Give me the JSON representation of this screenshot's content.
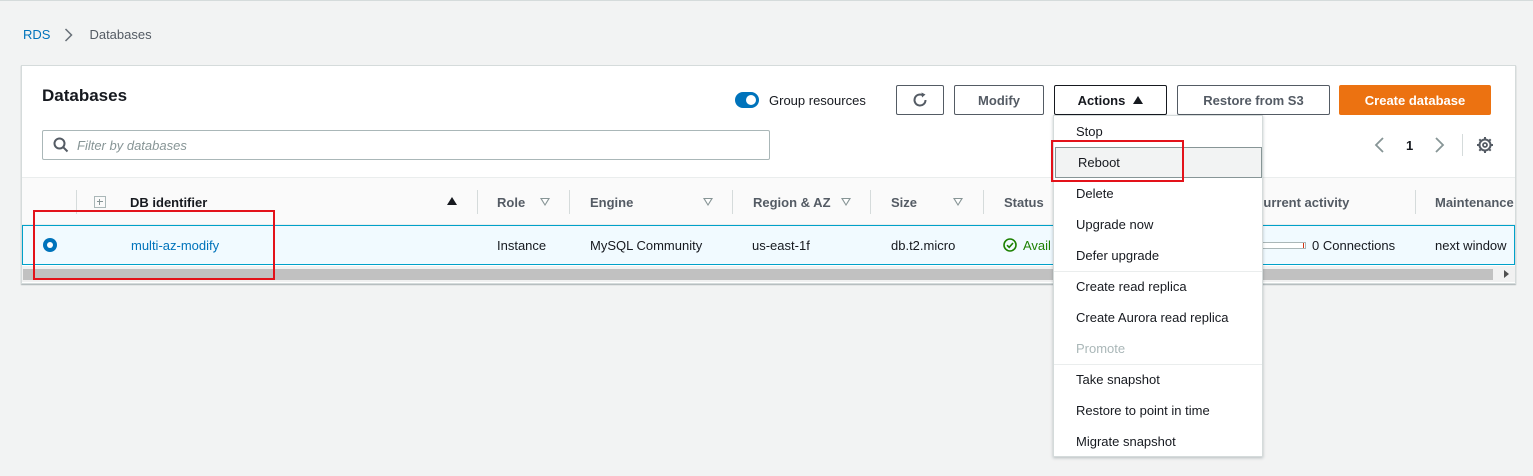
{
  "breadcrumb": {
    "root": "RDS",
    "current": "Databases"
  },
  "panel": {
    "title": "Databases",
    "group_resources_label": "Group resources",
    "group_resources_enabled": true,
    "buttons": {
      "modify": "Modify",
      "actions": "Actions",
      "restore": "Restore from S3",
      "create": "Create database"
    },
    "search": {
      "placeholder": "Filter by databases",
      "value": ""
    },
    "pager": {
      "page": "1"
    }
  },
  "table": {
    "headers": {
      "db_identifier": "DB identifier",
      "role": "Role",
      "engine": "Engine",
      "region": "Region & AZ",
      "size": "Size",
      "status": "Status",
      "activity": "Current activity",
      "maintenance": "Maintenance"
    },
    "row": {
      "db_identifier": "multi-az-modify",
      "role": "Instance",
      "engine": "MySQL Community",
      "region": "us-east-1f",
      "size": "db.t2.micro",
      "status": "Avail",
      "activity": "0 Connections",
      "maintenance": "next window"
    }
  },
  "actions_menu": {
    "items": [
      {
        "label": "Stop"
      },
      {
        "label": "Reboot"
      },
      {
        "label": "Delete"
      },
      {
        "label": "Upgrade now"
      },
      {
        "label": "Defer upgrade"
      },
      {
        "label": "Create read replica"
      },
      {
        "label": "Create Aurora read replica"
      },
      {
        "label": "Promote"
      },
      {
        "label": "Take snapshot"
      },
      {
        "label": "Restore to point in time"
      },
      {
        "label": "Migrate snapshot"
      }
    ]
  },
  "colors": {
    "accent": "#0073bb",
    "primary_button": "#ec7211",
    "status_ok": "#1d8102",
    "highlight": "#e3121a"
  }
}
